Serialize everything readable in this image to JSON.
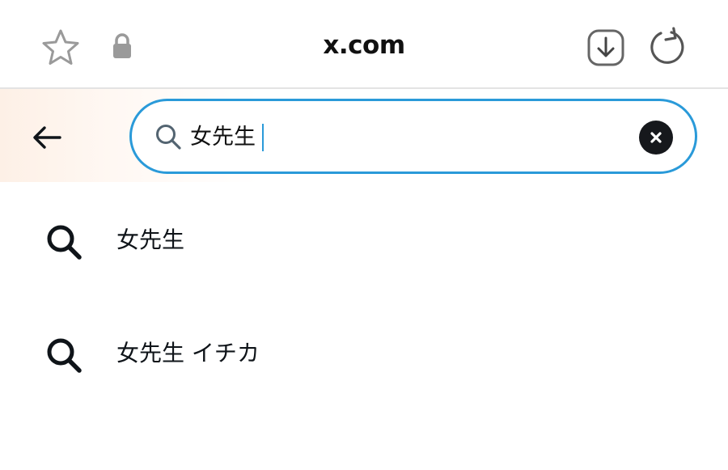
{
  "browser": {
    "url": "x.com",
    "icons": {
      "favorite": "star-icon",
      "secure": "lock-icon",
      "download": "download-icon",
      "reload": "reload-icon"
    }
  },
  "search": {
    "back_icon": "arrow-left-icon",
    "query": "女先生",
    "clear_icon": "close-icon",
    "accent_color": "#2a9ad9"
  },
  "suggestions": [
    {
      "icon": "search-icon",
      "label": "女先生"
    },
    {
      "icon": "search-icon",
      "label": "女先生 イチカ"
    }
  ]
}
